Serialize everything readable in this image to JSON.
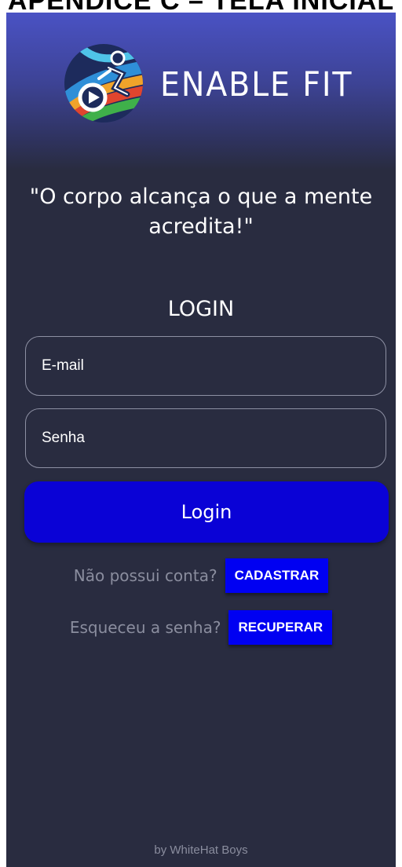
{
  "doc_heading": "APÊNDICE C – TELA INICIAL",
  "brand": {
    "name": "ENABLE FIT"
  },
  "quote": "\"O corpo alcança o que a mente acredita!\"",
  "login": {
    "title": "LOGIN",
    "email_placeholder": "E-mail",
    "password_placeholder": "Senha",
    "button_label": "Login"
  },
  "signup": {
    "prompt": "Não possui conta?",
    "button_label": "CADASTRAR"
  },
  "recover": {
    "prompt": "Esqueceu a senha?",
    "button_label": "RECUPERAR"
  },
  "footer": "by WhiteHat Boys",
  "colors": {
    "background": "#292c40",
    "header_gradient_top": "#4a52c4",
    "primary_button": "#0a02d6",
    "action_button": "#0000f2"
  },
  "icons": {
    "logo": "runner-play-logo"
  }
}
